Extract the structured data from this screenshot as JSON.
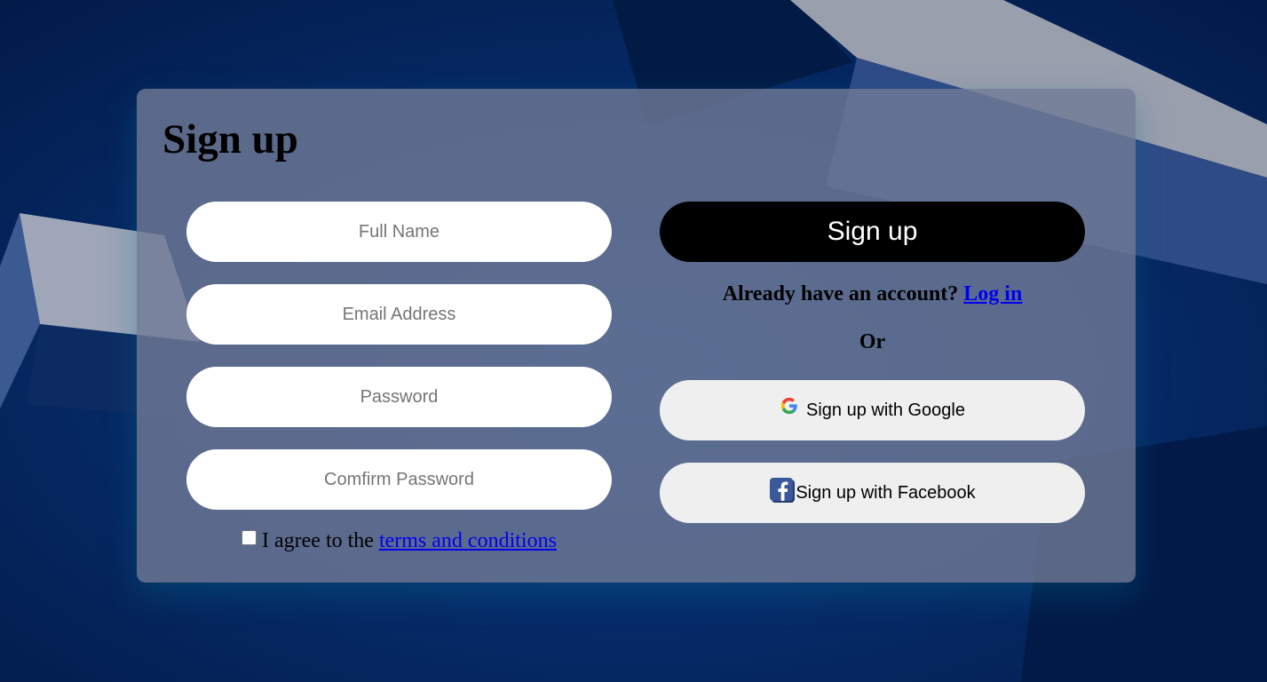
{
  "signup": {
    "title": "Sign up",
    "fields": {
      "full_name_placeholder": "Full Name",
      "email_placeholder": "Email Address",
      "password_placeholder": "Password",
      "confirm_password_placeholder": "Comfirm Password"
    },
    "terms": {
      "prefix": "I agree to the",
      "link_text": "terms and conditions",
      "checked": false
    },
    "submit_label": "Sign up",
    "login_prompt": "Already have an account?",
    "login_link": "Log in",
    "or_label": "Or",
    "google_label": "Sign up with Google",
    "facebook_label": "Sign up with Facebook"
  },
  "colors": {
    "background": "#03245c",
    "card": "#707a96",
    "submit_button": "#000000",
    "social_button": "#efefef",
    "link": "#0000ee"
  },
  "icons": {
    "google": "google-icon",
    "facebook": "facebook-icon"
  }
}
